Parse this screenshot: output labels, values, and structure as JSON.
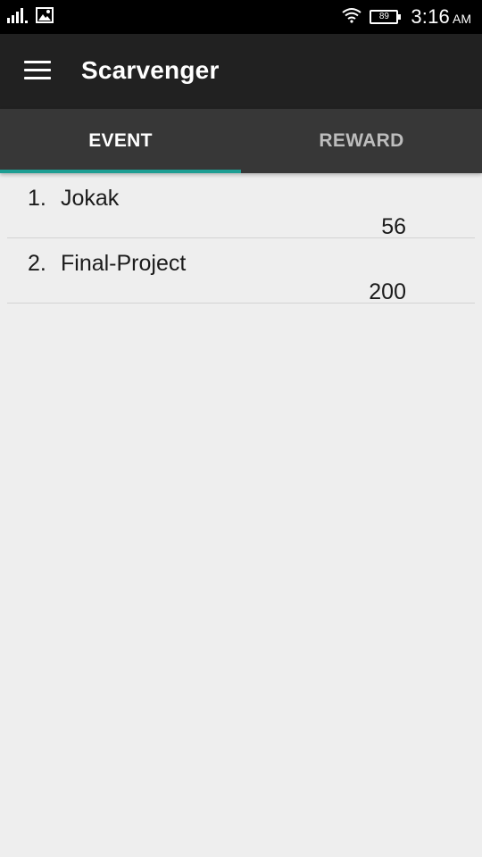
{
  "status_bar": {
    "signal_icon": "signal-bars-icon",
    "image_icon": "image-notification-icon",
    "wifi_icon": "wifi-icon",
    "battery_level": "89",
    "time": "3:16",
    "ampm": "AM"
  },
  "app_bar": {
    "menu_icon": "hamburger-menu-icon",
    "title": "Scarvenger"
  },
  "tabs": [
    {
      "label": "EVENT",
      "active": true
    },
    {
      "label": "REWARD",
      "active": false
    }
  ],
  "accent_color": "#1e9e93",
  "events": [
    {
      "number": "1.",
      "name": "Jokak",
      "value": "56"
    },
    {
      "number": "2.",
      "name": "Final-Project",
      "value": "200"
    }
  ]
}
